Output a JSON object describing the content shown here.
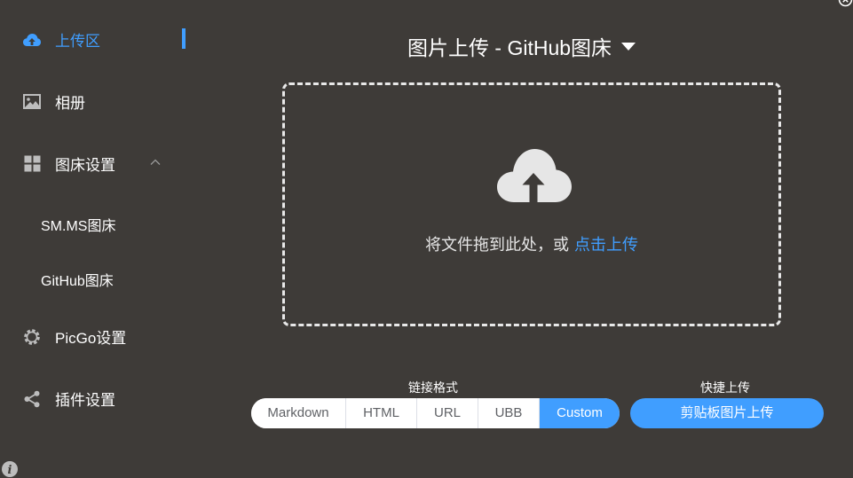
{
  "sidebar": {
    "items": [
      {
        "label": "上传区",
        "icon": "cloud-upload-icon",
        "active": true
      },
      {
        "label": "相册",
        "icon": "image-icon"
      },
      {
        "label": "图床设置",
        "icon": "grid-icon",
        "expanded": true
      },
      {
        "label": "PicGo设置",
        "icon": "gear-icon"
      },
      {
        "label": "插件设置",
        "icon": "share-icon"
      }
    ],
    "submenu": [
      {
        "label": "SM.MS图床"
      },
      {
        "label": "GitHub图床"
      }
    ]
  },
  "main": {
    "title": "图片上传 - GitHub图床",
    "dropzone": {
      "text": "将文件拖到此处，或",
      "link": "点击上传"
    },
    "link_format": {
      "label": "链接格式",
      "options": [
        "Markdown",
        "HTML",
        "URL",
        "UBB",
        "Custom"
      ],
      "selected": "Custom"
    },
    "quick_upload": {
      "label": "快捷上传",
      "button": "剪贴板图片上传"
    }
  },
  "colors": {
    "background": "#3e3b38",
    "accent": "#409eff",
    "text": "#ffffff"
  }
}
